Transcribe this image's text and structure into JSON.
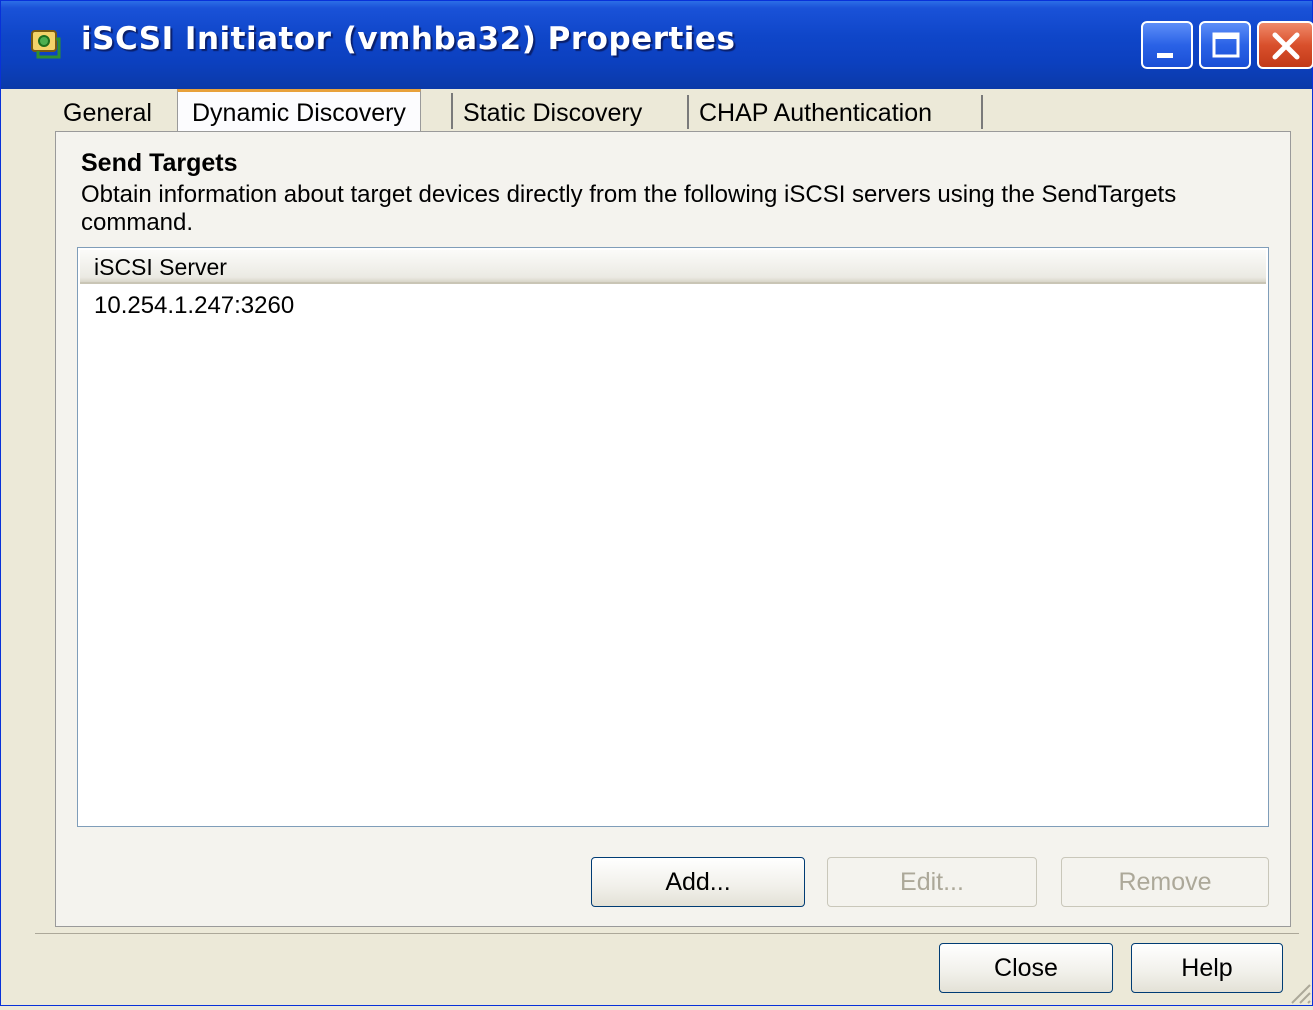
{
  "window": {
    "title": "iSCSI Initiator (vmhba32) Properties"
  },
  "tabs": [
    {
      "label": "General",
      "active": false
    },
    {
      "label": "Dynamic Discovery",
      "active": true
    },
    {
      "label": "Static Discovery",
      "active": false
    },
    {
      "label": "CHAP Authentication",
      "active": false
    }
  ],
  "section": {
    "title": "Send Targets",
    "description": "Obtain information about target devices directly from the following iSCSI servers using the SendTargets command."
  },
  "list": {
    "column_header": "iSCSI Server",
    "rows": [
      "10.254.1.247:3260"
    ]
  },
  "actions": {
    "add_label": "Add...",
    "edit_label": "Edit...",
    "remove_label": "Remove"
  },
  "dialog_buttons": {
    "close_label": "Close",
    "help_label": "Help"
  },
  "icons": {
    "app": "iscsi-initiator-icon",
    "minimize": "minimize-icon",
    "maximize": "maximize-icon",
    "close": "close-icon"
  },
  "colors": {
    "titlebar": "#0f46c9",
    "active_tab_accent": "#e8a13a",
    "window_bg": "#ece9d8"
  }
}
